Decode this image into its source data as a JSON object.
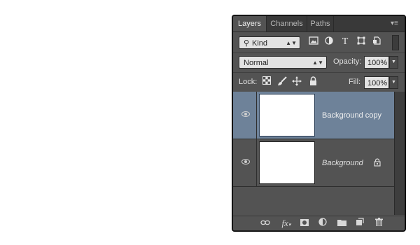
{
  "panel": {
    "tabs": [
      {
        "label": "Layers",
        "active": true
      },
      {
        "label": "Channels",
        "active": false
      },
      {
        "label": "Paths",
        "active": false
      }
    ],
    "menu_icon": "panel-menu-icon"
  },
  "filter": {
    "kind_label": "Kind",
    "icons": [
      "image-filter-icon",
      "adjustment-filter-icon",
      "type-filter-icon",
      "shape-filter-icon",
      "smart-object-filter-icon"
    ]
  },
  "blend": {
    "mode": "Normal",
    "opacity_label": "Opacity:",
    "opacity_value": "100%"
  },
  "lock": {
    "label": "Lock:",
    "fill_label": "Fill:",
    "fill_value": "100%",
    "icons": [
      "lock-transparent-icon",
      "lock-image-icon",
      "lock-position-icon",
      "lock-all-icon"
    ]
  },
  "layers": [
    {
      "name": "Background copy",
      "selected": true,
      "locked": false
    },
    {
      "name": "Background",
      "selected": false,
      "locked": true
    }
  ],
  "footer": {
    "icons": [
      "link-layers-icon",
      "fx-icon",
      "add-mask-icon",
      "adjustment-layer-icon",
      "new-group-icon",
      "new-layer-icon",
      "delete-layer-icon"
    ],
    "fx_label": "fx"
  },
  "colors": {
    "panel_bg": "#535353",
    "selected_layer": "#6e8299",
    "tab_bar": "#393939"
  }
}
